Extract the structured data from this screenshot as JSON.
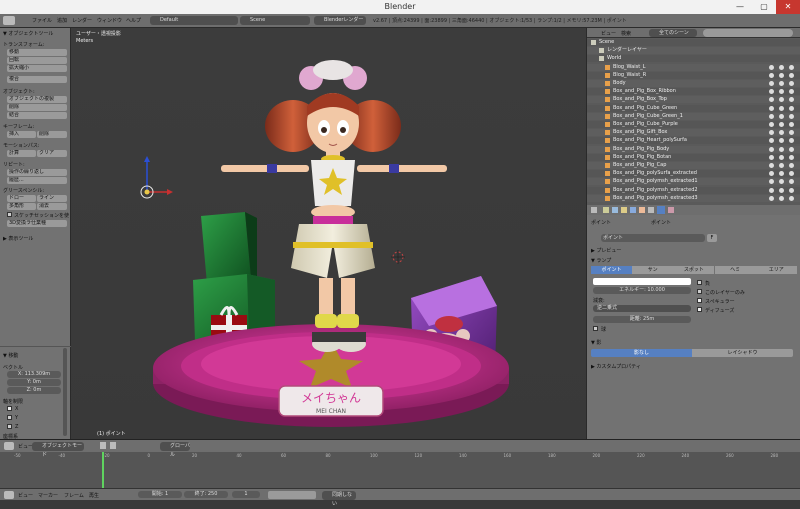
{
  "window": {
    "title": "Blender",
    "minimize": "—",
    "maximize": "▢",
    "close": "✕"
  },
  "topbar": {
    "menus": [
      "ファイル",
      "追加",
      "レンダー",
      "ウィンドウ",
      "ヘルプ"
    ],
    "layout": "Default",
    "scene": "Scene",
    "engine": "Blenderレンダー",
    "stats": "v2.67 | 頂点:24399 | 面:23899 | 三角面:46440 | オブジェクト:1/53 | ランプ:1/2 | メモリ:57.23M | ポイント"
  },
  "toolshelf": {
    "header": "▼ オブジェクトツール",
    "transform_header": "トランスフォーム:",
    "transform_buttons": [
      "移動",
      "回転",
      "拡大縮小",
      "複合"
    ],
    "object_header": "オブジェクト:",
    "object_buttons": [
      "オブジェクトの複製",
      "削除",
      "結合"
    ],
    "keyframe_header": "キーフレーム:",
    "keyframe_buttons": [
      "挿入",
      "削除"
    ],
    "motion_header": "モーションパス:",
    "motion_buttons": [
      "計算",
      "クリア"
    ],
    "repeat_header": "リピート:",
    "repeat_buttons": [
      "操作の繰り返し",
      "履歴..."
    ],
    "grease_header": "グリースペンシル:",
    "grease_buttons": [
      "ドロー",
      "ライン",
      "多角形",
      "消去"
    ],
    "grease_check": "スケッチセッションを使",
    "grease_button2": "3D変換ラ仕業種",
    "view3d_header": "▶ 表示ツール",
    "move_header": "▼ 移動",
    "vector_label": "ベクトル",
    "vector_x": "X: 113.309m",
    "vector_y": "Y: 0m",
    "vector_z": "Z: 0m",
    "axis_header": "軸を制限",
    "axis_x": "X",
    "axis_y": "Y",
    "axis_z": "Z",
    "orient_label": "座標系"
  },
  "viewport": {
    "view_name": "ユーザー・透視投影",
    "units": "Meters",
    "object_label": "(1) ポイント",
    "plate_text": "メイちゃん",
    "plate_sub": "MEI CHAN",
    "header_mode": "オブジェクトモード",
    "header_shading": "グローバル",
    "header_menus": [
      "ビュー",
      "選択",
      "オブジェクト"
    ]
  },
  "outliner": {
    "header_menus": [
      "ビュー",
      "検索"
    ],
    "filter": "全てのシーン",
    "items": [
      "Scene",
      "レンダーレイヤー",
      "World",
      "Blog_Waist_L",
      "Blog_Waist_R",
      "Body",
      "Box_and_Pig_Box_Ribbon",
      "Box_and_Pig_Box_Top",
      "Box_and_Pig_Cube_Green",
      "Box_and_Pig_Cube_Green_1",
      "Box_and_Pig_Cube_Purple",
      "Box_and_Pig_Gift_Box",
      "Box_and_Pig_Heart_polySurfa",
      "Box_and_Pig_Pig_Body",
      "Box_and_Pig_Pig_Botan",
      "Box_and_Pig_Pig_Cap",
      "Box_and_Pig_polySurfa_extracted",
      "Box_and_Pig_polymsh_extracted1",
      "Box_and_Pig_polymsh_extracted2",
      "Box_and_Pig_polymsh_extracted3"
    ]
  },
  "properties": {
    "breadcrumb_obj": "ポイント",
    "breadcrumb_data": "ポイント",
    "lamp_name": "ポイント",
    "lamp_users": "F",
    "preview_header": "▶ プレビュー",
    "lamp_header": "▼ ランプ",
    "lamp_types": [
      "ポイント",
      "サン",
      "スポット",
      "ヘミ",
      "エリア"
    ],
    "energy": "エネルギー: 10.000",
    "falloff_label": "減衰:",
    "falloff": "逆二乗式",
    "distance": "距離: 25m",
    "opt_negative": "負",
    "opt_layer": "このレイヤーのみ",
    "opt_specular": "スペキュラー",
    "opt_diffuse": "ディフューズ",
    "opt_sphere": "球",
    "shadow_header": "▼ 影",
    "shadow_none": "影なし",
    "shadow_ray": "レイシャドウ",
    "custom_header": "▶ カスタムプロパティ"
  },
  "timeline": {
    "ticks": [
      "-50",
      "-40",
      "-20",
      "0",
      "20",
      "40",
      "60",
      "80",
      "100",
      "120",
      "140",
      "160",
      "180",
      "200",
      "220",
      "240",
      "260",
      "280"
    ],
    "menus": [
      "ビュー",
      "マーカー",
      "フレーム",
      "再生"
    ],
    "start": "開始: 1",
    "end": "終了: 250",
    "current": "1",
    "sync": "同期しない"
  },
  "colors": {
    "accent": "#5680c2",
    "header_bg": "#6e6e6e",
    "panel_bg": "#727272",
    "viewport_bg": "#3a3a3a"
  }
}
